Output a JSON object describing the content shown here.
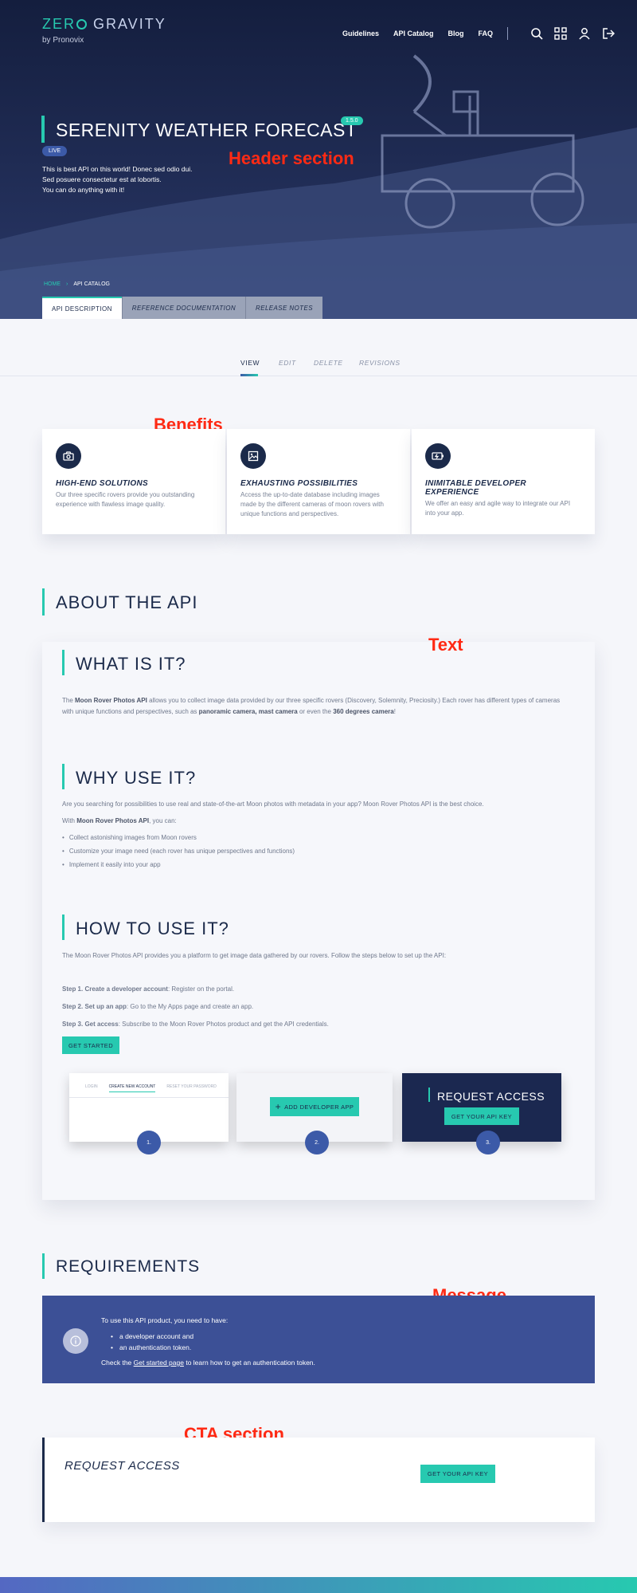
{
  "header": {
    "logo_main": "ZERO GRAVITY",
    "logo_main_a": "ZER",
    "logo_main_b": "GRAVITY",
    "logo_sub": "by Pronovix",
    "nav": [
      "Guidelines",
      "API Catalog",
      "Blog",
      "FAQ"
    ],
    "icons": [
      "search-icon",
      "grid-icon",
      "user-icon",
      "logout-icon"
    ],
    "title": "SERENITY WEATHER FORECAST",
    "version": "1.5.0",
    "status": "LIVE",
    "description": [
      "This is best API on this world! Donec sed odio dui.",
      "Sed posuere consectetur est at lobortis.",
      "You can do anything with it!"
    ],
    "breadcrumb": [
      "HOME",
      "API CATALOG"
    ],
    "tabs": [
      "API DESCRIPTION",
      "REFERENCE DOCUMENTATION",
      "RELEASE NOTES"
    ]
  },
  "labels": {
    "header": "Header section",
    "benefits": "Benefits",
    "text": "Text",
    "message": "Message",
    "cta": "CTA section"
  },
  "subtabs": [
    "VIEW",
    "EDIT",
    "DELETE",
    "REVISIONS"
  ],
  "benefits": [
    {
      "icon": "camera-icon",
      "title": "HIGH-END SOLUTIONS",
      "desc": "Our three specific rovers provide you outstanding experience with flawless image quality."
    },
    {
      "icon": "image-icon",
      "title": "EXHAUSTING POSSIBILITIES",
      "desc": "Access the up-to-date database including images made by the different cameras of moon rovers with unique functions and perspectives."
    },
    {
      "icon": "battery-icon",
      "title": "INIMITABLE DEVELOPER EXPERIENCE",
      "desc": "We offer an easy and agile way to integrate our API into your app."
    }
  ],
  "about": {
    "heading": "ABOUT THE API",
    "what_heading": "WHAT IS IT?",
    "what_text_1": "The ",
    "what_bold_1": "Moon Rover Photos API",
    "what_text_2": " allows you to collect image data provided by our three specific rovers (Discovery, Solemnity, Preciosity.) Each rover has different types of cameras with unique functions and perspectives, such as ",
    "what_bold_2": "panoramic camera, mast camera",
    "what_text_3": " or even the ",
    "what_bold_3": "360 degrees camera",
    "what_text_4": "!",
    "why_heading": "WHY USE IT?",
    "why_text": "Are you searching for possibilities to use real and state-of-the-art Moon photos with metadata in your app? Moon Rover Photos API is the best choice.",
    "with_text_1": "With ",
    "with_bold": "Moon Rover Photos API",
    "with_text_2": ", you can:",
    "why_list": [
      "Collect astonishing images from Moon rovers",
      "Customize your image need (each rover has unique perspectives and functions)",
      "Implement it easily into your app"
    ],
    "how_heading": "HOW TO USE IT?",
    "how_text": "The Moon Rover Photos API provides you a platform to get image data gathered by our rovers. Follow the steps below to set up the API:",
    "steps": [
      {
        "bold": "Step 1. Create a developer account",
        "text": ": Register on the portal."
      },
      {
        "bold": "Step 2. Set up an app",
        "text": ": Go to the My Apps page and create an app."
      },
      {
        "bold": "Step 3. Get access",
        "text": ": Subscribe to the Moon Rover Photos product and get the API credentials."
      }
    ],
    "get_started": "GET STARTED",
    "thumb1_tabs": [
      "LOGIN",
      "CREATE NEW ACCOUNT",
      "RESET YOUR PASSWORD"
    ],
    "thumb2_button": "ADD DEVELOPER APP",
    "thumb3_title": "REQUEST ACCESS",
    "thumb3_button": "GET YOUR API KEY",
    "step_numbers": [
      "1.",
      "2.",
      "3."
    ]
  },
  "requirements": {
    "heading": "REQUIREMENTS",
    "intro": "To use this API product, you need to have:",
    "list": [
      "a developer account and",
      "an authentication token."
    ],
    "check_1": "Check the ",
    "check_link": "Get started page",
    "check_2": " to learn how to get an authentication token."
  },
  "cta": {
    "title": "REQUEST ACCESS",
    "button": "GET YOUR API KEY"
  }
}
